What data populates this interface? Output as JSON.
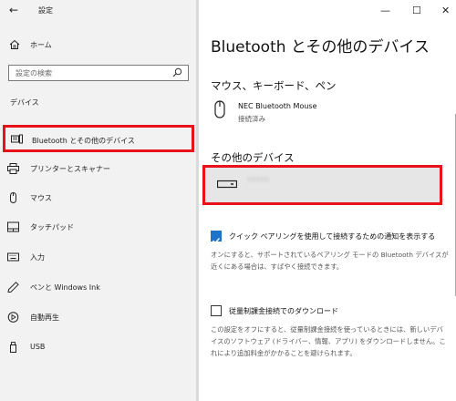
{
  "window": {
    "title": "設定",
    "controls": [
      "—",
      "☐",
      "✕"
    ]
  },
  "sidebar": {
    "home_label": "ホーム",
    "search_placeholder": "設定の検索",
    "section_label": "デバイス",
    "items": [
      {
        "label": "Bluetooth とその他のデバイス",
        "icon": "bluetooth-devices-icon",
        "selected": true
      },
      {
        "label": "プリンターとスキャナー",
        "icon": "printer-icon"
      },
      {
        "label": "マウス",
        "icon": "mouse-icon"
      },
      {
        "label": "タッチパッド",
        "icon": "touchpad-icon"
      },
      {
        "label": "入力",
        "icon": "keyboard-icon"
      },
      {
        "label": "ペンと Windows Ink",
        "icon": "pen-icon"
      },
      {
        "label": "自動再生",
        "icon": "autoplay-icon"
      },
      {
        "label": "USB",
        "icon": "usb-icon"
      }
    ]
  },
  "main": {
    "title": "Bluetooth とその他のデバイス",
    "mouse_section": {
      "heading": "マウス、キーボード、ペン",
      "device_name": "NEC Bluetooth Mouse",
      "device_status": "接続済み"
    },
    "other_section": {
      "heading": "その他のデバイス",
      "device_name": "XXXXX"
    },
    "swift_pair": {
      "checked": true,
      "label": "クイック ペアリングを使用して接続するための通知を表示する",
      "description": "オンにすると、サポートされているペアリング モードの Bluetooth デバイスが近くにある場合は、すばやく接続できます。"
    },
    "metered": {
      "checked": false,
      "label": "従量制課金接続でのダウンロード",
      "description": "この設定をオフにすると、従量制課金接続を使っているときには、新しいデバイスのソフトウェア (ドライバー、情報、アプリ) をダウンロードしません。これにより追加料金がかかることを避けられます。"
    }
  },
  "colors": {
    "highlight": "#e8121b",
    "accent": "#1d73c9",
    "sidebar_bg": "#f2f2f2"
  }
}
